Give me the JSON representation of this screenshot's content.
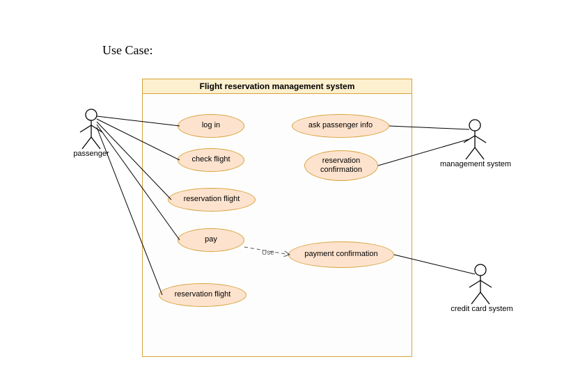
{
  "title": "Use Case:",
  "system_title": "Flight reservation management system",
  "usecases": {
    "login": "log in",
    "check_flight": "check flight",
    "reservation_flight_1": "reservation flight",
    "pay": "pay",
    "reservation_flight_2": "reservation flight",
    "ask_passenger_info": "ask passenger info",
    "reservation_confirmation": "reservation\nconfirmation",
    "payment_confirmation": "payment confirmation"
  },
  "actors": {
    "passenger": "passenger",
    "management_system": "management system",
    "credit_card_system": "credit card system"
  },
  "relation_label": "Use",
  "chart_data": {
    "type": "uml-use-case",
    "system": "Flight reservation management system",
    "actors": [
      "passenger",
      "management system",
      "credit card system"
    ],
    "usecases": [
      "log in",
      "check flight",
      "reservation flight",
      "pay",
      "reservation flight",
      "ask passenger info",
      "reservation confirmation",
      "payment confirmation"
    ],
    "associations": [
      {
        "actor": "passenger",
        "usecase": "log in"
      },
      {
        "actor": "passenger",
        "usecase": "check flight"
      },
      {
        "actor": "passenger",
        "usecase": "reservation flight"
      },
      {
        "actor": "passenger",
        "usecase": "pay"
      },
      {
        "actor": "passenger",
        "usecase": "reservation flight"
      },
      {
        "actor": "management system",
        "usecase": "ask passenger info"
      },
      {
        "actor": "management system",
        "usecase": "reservation confirmation"
      },
      {
        "actor": "credit card system",
        "usecase": "payment confirmation"
      }
    ],
    "dependencies": [
      {
        "from": "pay",
        "to": "payment confirmation",
        "stereotype": "Use"
      }
    ]
  }
}
